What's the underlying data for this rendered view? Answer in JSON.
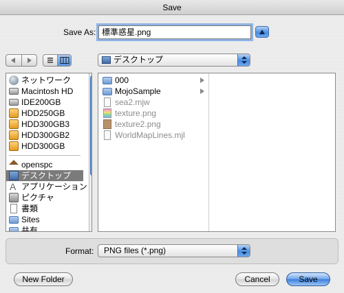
{
  "window": {
    "title": "Save"
  },
  "saveas": {
    "label": "Save As:",
    "value": "標準惑星.png"
  },
  "location": {
    "current": "デスクトップ"
  },
  "sidebar": {
    "items": [
      {
        "label": "ネットワーク",
        "icon": "network-globe-icon"
      },
      {
        "label": "Macintosh HD",
        "icon": "hard-drive-icon"
      },
      {
        "label": "IDE200GB",
        "icon": "hard-drive-icon"
      },
      {
        "label": "HDD250GB",
        "icon": "external-drive-icon"
      },
      {
        "label": "HDD300GB3",
        "icon": "external-drive-icon"
      },
      {
        "label": "HDD300GB2",
        "icon": "external-drive-icon"
      },
      {
        "label": "HDD300GB",
        "icon": "external-drive-icon"
      },
      {
        "label": "openspc",
        "icon": "home-icon"
      },
      {
        "label": "デスクトップ",
        "icon": "desktop-icon",
        "selected": true
      },
      {
        "label": "アプリケーション",
        "icon": "applications-icon"
      },
      {
        "label": "ピクチャ",
        "icon": "pictures-icon"
      },
      {
        "label": "書類",
        "icon": "documents-icon"
      },
      {
        "label": "Sites",
        "icon": "folder-icon"
      },
      {
        "label": "共有",
        "icon": "folder-icon"
      }
    ]
  },
  "browser": {
    "files": [
      {
        "name": "000",
        "kind": "folder",
        "dim": false
      },
      {
        "name": "MojoSample",
        "kind": "folder",
        "dim": false
      },
      {
        "name": "sea2.mjw",
        "kind": "doc",
        "dim": true
      },
      {
        "name": "texture.png",
        "kind": "color",
        "dim": true
      },
      {
        "name": "texture2.png",
        "kind": "tex",
        "dim": true
      },
      {
        "name": "WorldMapLines.mjl",
        "kind": "doc",
        "dim": true
      }
    ]
  },
  "format": {
    "label": "Format:",
    "value": "PNG files (*.png)"
  },
  "buttons": {
    "new_folder": "New Folder",
    "cancel": "Cancel",
    "save": "Save"
  }
}
